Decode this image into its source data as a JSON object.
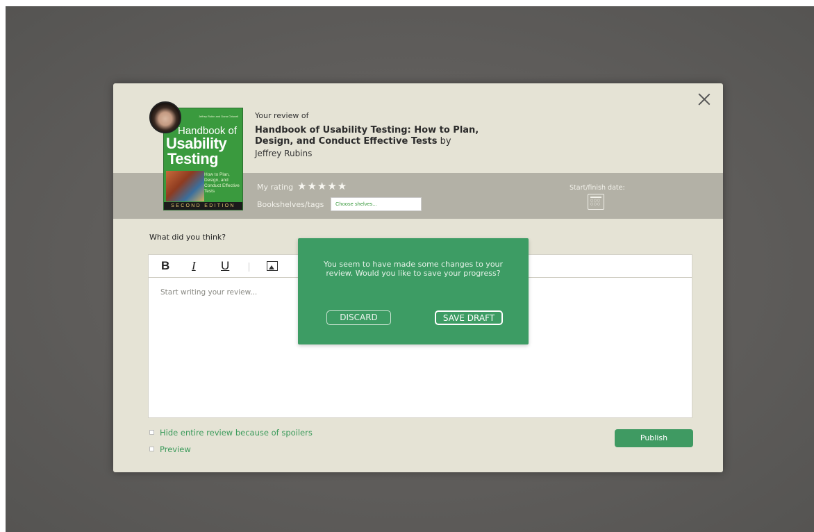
{
  "modal": {
    "your_review_of": "Your review of",
    "book_title": "Handbook of Usability Testing: How to Plan, Design, and Conduct Effective Tests",
    "by": "by",
    "author": "Jeffrey Rubins",
    "cover": {
      "authors": "Jeffrey Rubin and Dana Chisnell",
      "title_line1": "Handbook of",
      "title_line2": "Usability",
      "title_line3": "Testing",
      "subtitle": "How to Plan, Design, and Conduct Effective Tests",
      "edition": "SECOND EDITION"
    },
    "rating_label": "My rating",
    "stars": "★★★★★",
    "rating_value": 5,
    "shelves_label": "Bookshelves/tags",
    "shelves_placeholder": "Choose shelves...",
    "date_label": "Start/finish date:",
    "calendar_icon": "calendar-icon",
    "prompt": "What did you think?",
    "toolbar": {
      "bold": "B",
      "italic": "I",
      "underline": "U",
      "image_icon": "image-icon"
    },
    "editor_placeholder": "Start writing your review...",
    "hide_spoilers": "Hide entire review because of spoilers",
    "preview": "Preview",
    "publish": "Publish"
  },
  "popup": {
    "message": "You seem to have made some changes to your review. Would you like to save your progress?",
    "discard": "DISCARD",
    "save_draft": "SAVE DRAFT"
  },
  "colors": {
    "modal_bg": "#e5e3d5",
    "band": "#b3b1a6",
    "accent_green": "#3d9c64",
    "overlay": "#5f5d5b"
  }
}
